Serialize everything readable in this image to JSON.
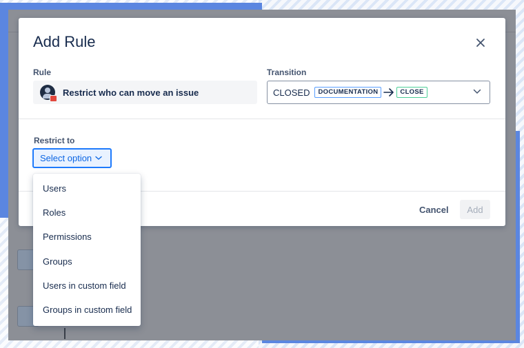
{
  "modal": {
    "title": "Add Rule",
    "close_icon": "close-icon",
    "rule_label": "Rule",
    "rule_value": "Restrict who can move an issue",
    "transition_label": "Transition",
    "transition": {
      "from_status": "CLOSED",
      "workflow_lozenge": "DOCUMENTATION",
      "arrow": "→",
      "to_lozenge": "CLOSE"
    },
    "restrict_label": "Restrict to",
    "select_placeholder": "Select option",
    "cancel_label": "Cancel",
    "add_label": "Add"
  },
  "menu": {
    "options": [
      "Users",
      "Roles",
      "Permissions",
      "Groups",
      "Users in custom field",
      "Groups in custom field"
    ]
  },
  "colors": {
    "accent_blue": "#0c66e4",
    "focus_border": "#1d7afc",
    "lock_red": "#e2483d",
    "frame_blue": "#5b86e0"
  }
}
